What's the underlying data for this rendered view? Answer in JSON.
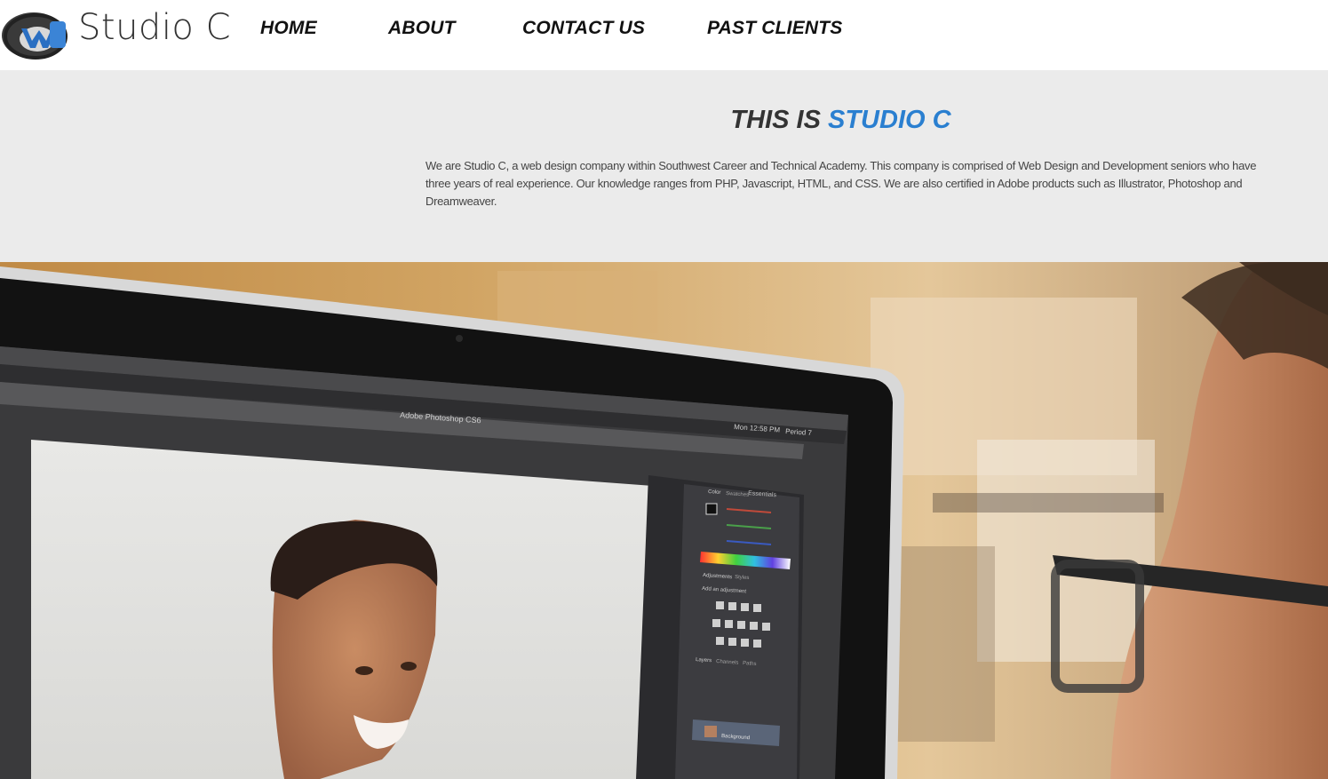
{
  "site": {
    "brand": "Studio C",
    "accent_color": "#2a7fd0"
  },
  "nav": {
    "items": [
      {
        "label": "HOME"
      },
      {
        "label": "ABOUT"
      },
      {
        "label": "CONTACT US"
      },
      {
        "label": "PAST CLIENTS"
      }
    ]
  },
  "about": {
    "title_prefix": "THIS IS ",
    "title_highlight": "STUDIO C",
    "body": "We are Studio C, a web design company within Southwest Career and Technical Academy. This company is comprised of Web Design and Development seniors who have three years of real experience. Our knowledge ranges from PHP, Javascript, HTML, and CSS. We are also certified in Adobe products such as Illustrator, Photoshop and Dreamweaver."
  },
  "hero": {
    "app_title": "Adobe Photoshop CS6",
    "menubar_clock": "Mon 12:58 PM",
    "menubar_period": "Period 7",
    "panel_workspace": "Essentials",
    "panel_tabs": [
      "Color",
      "Swatches"
    ],
    "adjust_tabs": [
      "Adjustments",
      "Styles"
    ],
    "adjust_hint": "Add an adjustment",
    "layers_tabs": [
      "Layers",
      "Channels",
      "Paths"
    ],
    "layer_name": "Background"
  }
}
